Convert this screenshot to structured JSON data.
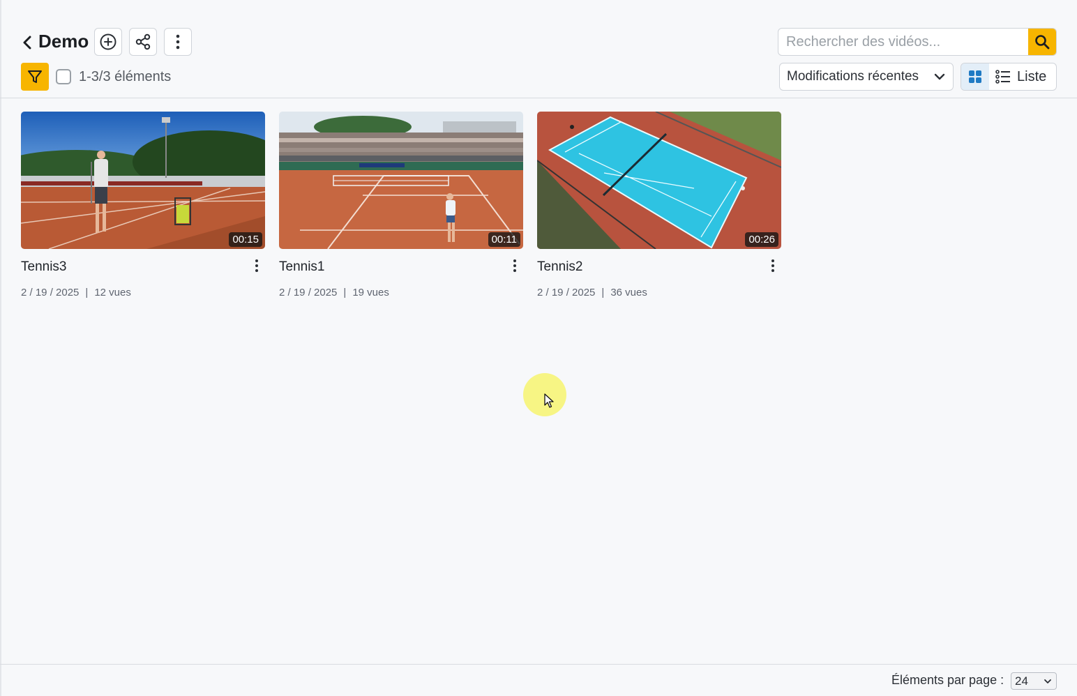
{
  "header": {
    "title": "Demo",
    "search_placeholder": "Rechercher des vidéos...",
    "count_label": "1-3/3 éléments",
    "sort_label": "Modifications récentes",
    "list_view_label": "Liste",
    "accent_color": "#f7b500"
  },
  "videos": [
    {
      "title": "Tennis3",
      "duration": "00:15",
      "date": "2 / 19 / 2025",
      "views": "12 vues",
      "thumbnail": "clay-court-player-with-ball-basket"
    },
    {
      "title": "Tennis1",
      "duration": "00:11",
      "date": "2 / 19 / 2025",
      "views": "19 vues",
      "thumbnail": "clay-court-stadium-match"
    },
    {
      "title": "Tennis2",
      "duration": "00:26",
      "date": "2 / 19 / 2025",
      "views": "36 vues",
      "thumbnail": "aerial-blue-hard-court"
    }
  ],
  "footer": {
    "per_page_label": "Éléments par page :",
    "per_page_value": "24"
  }
}
